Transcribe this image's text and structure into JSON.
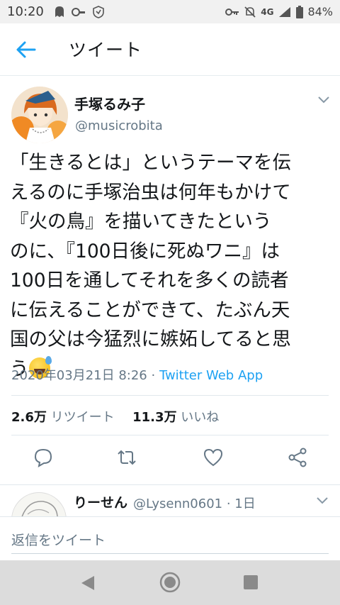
{
  "status_bar": {
    "time": "10:20",
    "network": "4G",
    "battery": "84%"
  },
  "header": {
    "title": "ツイート"
  },
  "tweet": {
    "display_name": "手塚るみ子",
    "handle": "@musicrobita",
    "text_lines": [
      "「生きるとは」というテーマを伝",
      "えるのに手塚治虫は何年もかけて",
      "『火の鳥』を描いてきたという",
      "のに、『100日後に死ぬワニ』は",
      "100日を通してそれを多くの読者",
      "に伝えることができて、たぶん天",
      "国の父は今猛烈に嫉妬してると思",
      "う"
    ],
    "emoji": "sweat-smile-emoji",
    "timestamp": "2020年03月21日 8:26",
    "separator": " · ",
    "app": "Twitter Web App",
    "retweets_count": "2.6万",
    "retweets_label": "リツイート",
    "likes_count": "11.3万",
    "likes_label": "いいね"
  },
  "reply_preview": {
    "name": "りーせん",
    "handle_time": "@Lysenn0601 · 1日"
  },
  "compose": {
    "placeholder": "返信をツイート"
  },
  "colors": {
    "accent": "#1da1f2",
    "muted": "#657786",
    "text": "#14171a"
  }
}
